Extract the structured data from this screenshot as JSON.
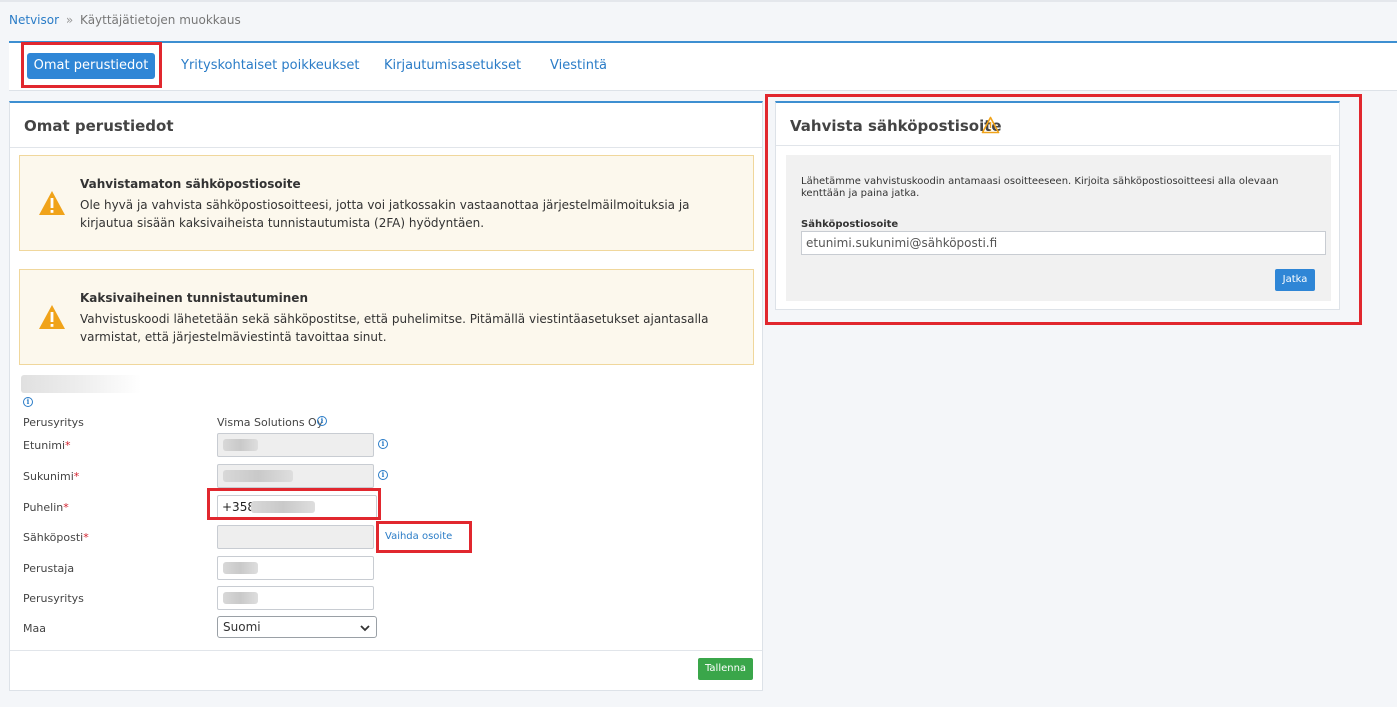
{
  "breadcrumb": {
    "home": "Netvisor",
    "separator": "»",
    "current": "Käyttäjätietojen muokkaus"
  },
  "tabs": {
    "basic": "Omat perustiedot",
    "exceptions": "Yrityskohtaiset poikkeukset",
    "login": "Kirjautumisasetukset",
    "communication": "Viestintä"
  },
  "left_panel": {
    "title": "Omat perustiedot",
    "alert1": {
      "title": "Vahvistamaton sähköpostiosoite",
      "text": "Ole hyvä ja vahvista sähköpostiosoitteesi, jotta voi jatkossakin vastaanottaa järjestelmäilmoituksia ja kirjautua sisään kaksivaiheista tunnistautumista (2FA) hyödyntäen."
    },
    "alert2": {
      "title": "Kaksivaiheinen tunnistautuminen",
      "text": "Vahvistuskoodi lähetetään sekä sähköpostitse, että puhelimitse. Pitämällä viestintäasetukset ajantasalla varmistat, että järjestelmäviestintä tavoittaa sinut."
    },
    "form": {
      "company_label": "Perusyritys",
      "company_value": "Visma Solutions Oy",
      "first_name_label": "Etunimi",
      "last_name_label": "Sukunimi",
      "phone_label": "Puhelin",
      "phone_value": "+358",
      "email_label": "Sähköposti",
      "change_address_link": "Vaihda osoite",
      "founder_label": "Perustaja",
      "base_company_label": "Perusyritys",
      "country_label": "Maa",
      "country_value": "Suomi",
      "required_mark": "*"
    },
    "save_button": "Tallenna"
  },
  "right_panel": {
    "title": "Vahvista sähköpostisoite",
    "instructions": "Lähetämme vahvistuskoodin antamaasi osoitteeseen. Kirjoita sähköpostiosoitteesi alla olevaan kenttään ja paina jatka.",
    "email_label": "Sähköpostiosoite",
    "email_value": "etunimi.sukunimi@sähköposti.fi",
    "continue_button": "Jatka"
  },
  "icons": {
    "warning": "warning-triangle-icon",
    "info": "info-circle-icon",
    "dropdown": "chevron-down-icon"
  },
  "colors": {
    "accent": "#2f86d6",
    "link": "#2a7cc7",
    "warning": "#f0a31a",
    "save": "#3aa64a",
    "highlight": "#e1272e"
  }
}
